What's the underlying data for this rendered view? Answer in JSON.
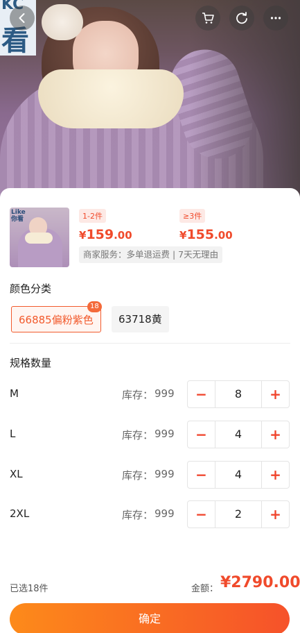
{
  "header": {
    "photo_badge_top": "KC",
    "photo_badge_char": "看"
  },
  "product": {
    "thumb_logo_line1": "Like",
    "thumb_logo_line2": "你看",
    "tiers": [
      {
        "range": "1-2件",
        "currency": "¥",
        "price_int": "159",
        "price_dec": ".00"
      },
      {
        "range": "≥3件",
        "currency": "¥",
        "price_int": "155",
        "price_dec": ".00"
      }
    ],
    "service": "商家服务：多单退运费 | 7天无理由"
  },
  "color_section": {
    "title": "颜色分类",
    "options": [
      {
        "label": "66885偏粉紫色",
        "count": "18",
        "selected": true
      },
      {
        "label": "63718黄",
        "selected": false
      }
    ]
  },
  "spec_section": {
    "title": "规格数量",
    "stock_label": "库存：",
    "minus": "−",
    "plus": "+",
    "rows": [
      {
        "size": "M",
        "stock": "999",
        "qty": "8"
      },
      {
        "size": "L",
        "stock": "999",
        "qty": "4"
      },
      {
        "size": "XL",
        "stock": "999",
        "qty": "4"
      },
      {
        "size": "2XL",
        "stock": "999",
        "qty": "2"
      }
    ]
  },
  "footer": {
    "selected_count": "已选18件",
    "amount_label": "金额：",
    "amount_value": "¥2790.00",
    "confirm_label": "确定"
  },
  "colors": {
    "accent": "#f04a2b",
    "button_gradient_start": "#fd8a1a",
    "button_gradient_end": "#f6522a"
  }
}
